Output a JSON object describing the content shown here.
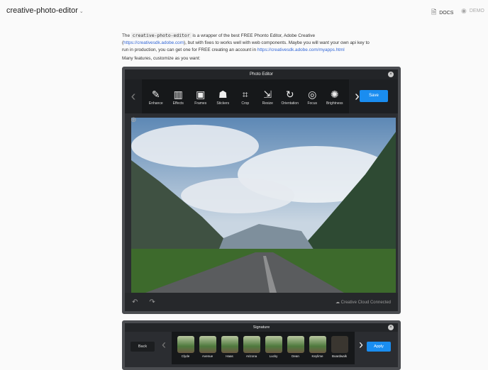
{
  "header": {
    "title": "creative-photo-editor",
    "docs": "DOCS",
    "demo": "DEMO"
  },
  "intro": {
    "the": "The ",
    "code": "creative-photo-editor",
    "t1": " is a wrapper of the best FREE Phonto Editor, Adobe Creative (",
    "link1": "https://creativesdk.adobe.com",
    "t2": "), but with fixes to works well with web components. Maybe you will want your own api key to run in production, you can get one for FREE creating an account in ",
    "link2": "https://creativesdk.adobe.com/myapps.html",
    "p2": "Many features, customize as you want:"
  },
  "editor": {
    "title": "Photo Editor",
    "save": "Save",
    "tools": [
      {
        "label": "Enhance",
        "icon": "✎"
      },
      {
        "label": "Effects",
        "icon": "▥"
      },
      {
        "label": "Frames",
        "icon": "▣"
      },
      {
        "label": "Stickers",
        "icon": "☗"
      },
      {
        "label": "Crop",
        "icon": "⌗"
      },
      {
        "label": "Resize",
        "icon": "⇲"
      },
      {
        "label": "Orientation",
        "icon": "↻"
      },
      {
        "label": "Focus",
        "icon": "◎"
      },
      {
        "label": "Brightness",
        "icon": "✺"
      }
    ],
    "footer": "Creative Cloud Connected"
  },
  "signature": {
    "title": "Signature",
    "back": "Back",
    "apply": "Apply",
    "filters": [
      "Clyde",
      "Avenue",
      "Haas",
      "Arizona",
      "Lucky",
      "Dean",
      "Keylime",
      "Boardwalk"
    ]
  }
}
